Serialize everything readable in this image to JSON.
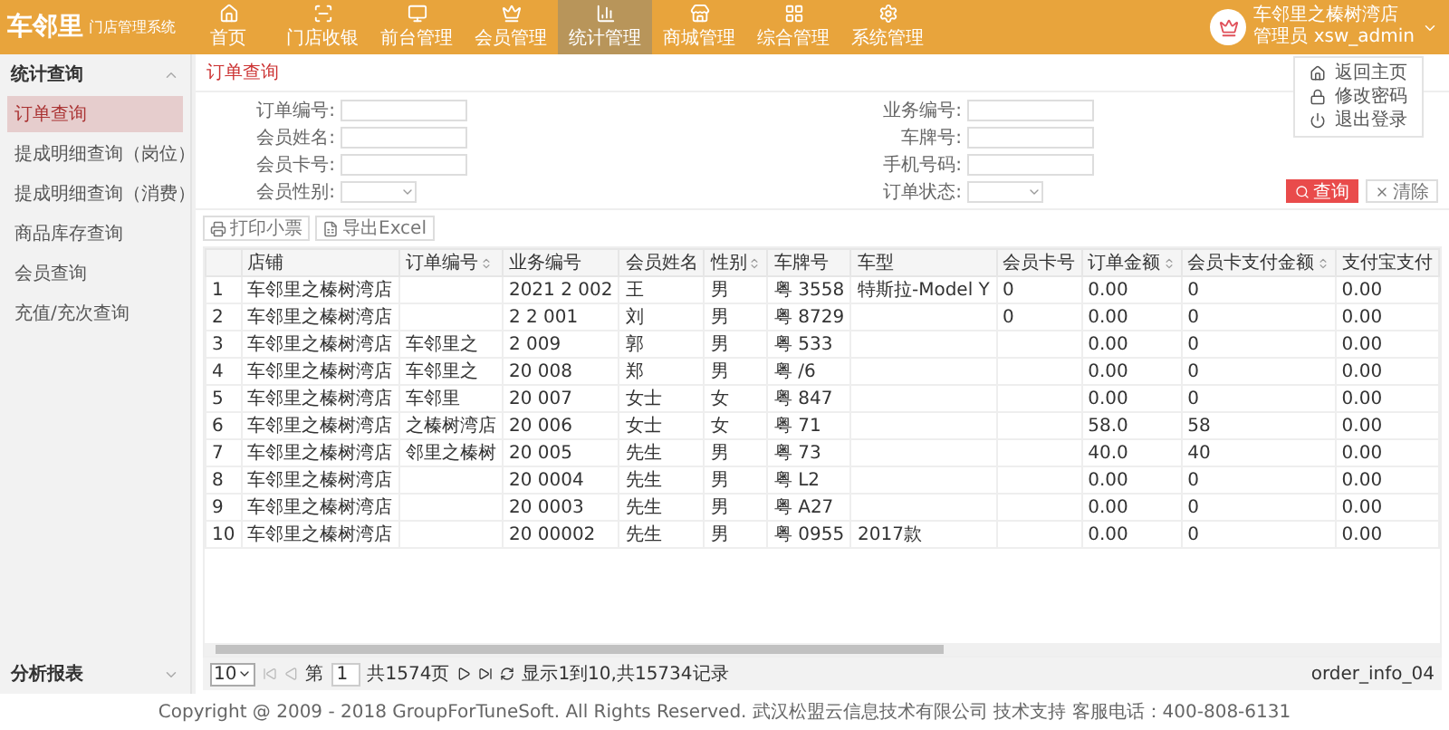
{
  "brand": {
    "name": "车邻里",
    "subtitle": "门店管理系统"
  },
  "nav": [
    {
      "label": "首页",
      "selected": false
    },
    {
      "label": "门店收银",
      "selected": false
    },
    {
      "label": "前台管理",
      "selected": false
    },
    {
      "label": "会员管理",
      "selected": false
    },
    {
      "label": "统计管理",
      "selected": true
    },
    {
      "label": "商城管理",
      "selected": false
    },
    {
      "label": "综合管理",
      "selected": false
    },
    {
      "label": "系统管理",
      "selected": false
    }
  ],
  "user": {
    "store": "车邻里之榛树湾店",
    "role": "管理员 xsw_admin"
  },
  "user_menu": [
    {
      "label": "返回主页"
    },
    {
      "label": "修改密码"
    },
    {
      "label": "退出登录"
    }
  ],
  "sidebar": [
    {
      "label": "统计查询",
      "expanded": true,
      "children": [
        {
          "label": "订单查询",
          "selected": true
        },
        {
          "label": "提成明细查询（岗位）",
          "selected": false
        },
        {
          "label": "提成明细查询（消费）",
          "selected": false
        },
        {
          "label": "商品库存查询",
          "selected": false
        },
        {
          "label": "会员查询",
          "selected": false
        },
        {
          "label": "充值/充次查询",
          "selected": false
        }
      ]
    },
    {
      "label": "分析报表",
      "expanded": false
    }
  ],
  "page_title": "订单查询",
  "form": {
    "left": [
      {
        "label": "订单编号:",
        "kind": "text"
      },
      {
        "label": "会员姓名:",
        "kind": "text"
      },
      {
        "label": "会员卡号:",
        "kind": "text"
      },
      {
        "label": "会员性别:",
        "kind": "select"
      }
    ],
    "right": [
      {
        "label": "业务编号:",
        "kind": "text"
      },
      {
        "label": "车牌号:",
        "kind": "text"
      },
      {
        "label": "手机号码:",
        "kind": "text"
      },
      {
        "label": "订单状态:",
        "kind": "select"
      }
    ],
    "search_button": "查询",
    "clear_button": "清除"
  },
  "toolbar": [
    {
      "label": "打印小票"
    },
    {
      "label": "导出Excel"
    }
  ],
  "table": {
    "columns": [
      {
        "label": "店铺",
        "sortable": false
      },
      {
        "label": "订单编号",
        "sortable": true
      },
      {
        "label": "业务编号",
        "sortable": false
      },
      {
        "label": "会员姓名",
        "sortable": false
      },
      {
        "label": "性别",
        "sortable": true
      },
      {
        "label": "车牌号",
        "sortable": false
      },
      {
        "label": "车型",
        "sortable": false
      },
      {
        "label": "会员卡号",
        "sortable": false
      },
      {
        "label": "订单金额",
        "sortable": true
      },
      {
        "label": "会员卡支付金额",
        "sortable": true
      },
      {
        "label": "支付宝支付",
        "sortable": false
      }
    ],
    "rows": [
      {
        "index": "1",
        "cells": [
          "车邻里之榛树湾店",
          "",
          "2021 2 002",
          "王",
          "男",
          "粤 3558",
          "特斯拉-Model Y",
          "0",
          "0.00",
          "0",
          "0.00"
        ]
      },
      {
        "index": "2",
        "cells": [
          "车邻里之榛树湾店",
          "",
          "2 2 001",
          "刘",
          "男",
          "粤 8729",
          "",
          "0",
          "0.00",
          "0",
          "0.00"
        ]
      },
      {
        "index": "3",
        "cells": [
          "车邻里之榛树湾店",
          "车邻里之",
          "2 009",
          "郭",
          "男",
          "粤 533",
          "",
          "",
          "0.00",
          "0",
          "0.00"
        ]
      },
      {
        "index": "4",
        "cells": [
          "车邻里之榛树湾店",
          "车邻里之",
          "20 008",
          "郑",
          "男",
          "粤 /6",
          "",
          "",
          "0.00",
          "0",
          "0.00"
        ]
      },
      {
        "index": "5",
        "cells": [
          "车邻里之榛树湾店",
          "车邻里",
          "20 007",
          "女士",
          "女",
          "粤 847",
          "",
          "",
          "0.00",
          "0",
          "0.00"
        ]
      },
      {
        "index": "6",
        "cells": [
          "车邻里之榛树湾店",
          "之榛树湾店",
          "20 006",
          "女士",
          "女",
          "粤 71",
          "",
          "",
          "58.0",
          "58",
          "0.00"
        ]
      },
      {
        "index": "7",
        "cells": [
          "车邻里之榛树湾店",
          "邻里之榛树",
          "20 005",
          "先生",
          "男",
          "粤 73",
          "",
          "",
          "40.0",
          "40",
          "0.00"
        ]
      },
      {
        "index": "8",
        "cells": [
          "车邻里之榛树湾店",
          "",
          "20 0004",
          "先生",
          "男",
          "粤 L2",
          "",
          "",
          "0.00",
          "0",
          "0.00"
        ]
      },
      {
        "index": "9",
        "cells": [
          "车邻里之榛树湾店",
          "",
          "20 0003",
          "先生",
          "男",
          "粤 A27",
          "",
          "",
          "0.00",
          "0",
          "0.00"
        ]
      },
      {
        "index": "10",
        "cells": [
          "车邻里之榛树湾店",
          "",
          "20 00002",
          "先生",
          "男",
          "粤 0955",
          "2017款",
          "",
          "0.00",
          "0",
          "0.00"
        ]
      }
    ]
  },
  "pagination": {
    "page_size": "10",
    "page_prefix": "第",
    "page": "1",
    "page_total": "共1574页",
    "summary": "显示1到10,共15734记录"
  },
  "page_code": "order_info_04",
  "footer": "Copyright @ 2009 - 2018 GroupForTuneSoft. All Rights Reserved. 武汉松盟云信息技术有限公司 技术支持 客服电话：400-808-6131"
}
